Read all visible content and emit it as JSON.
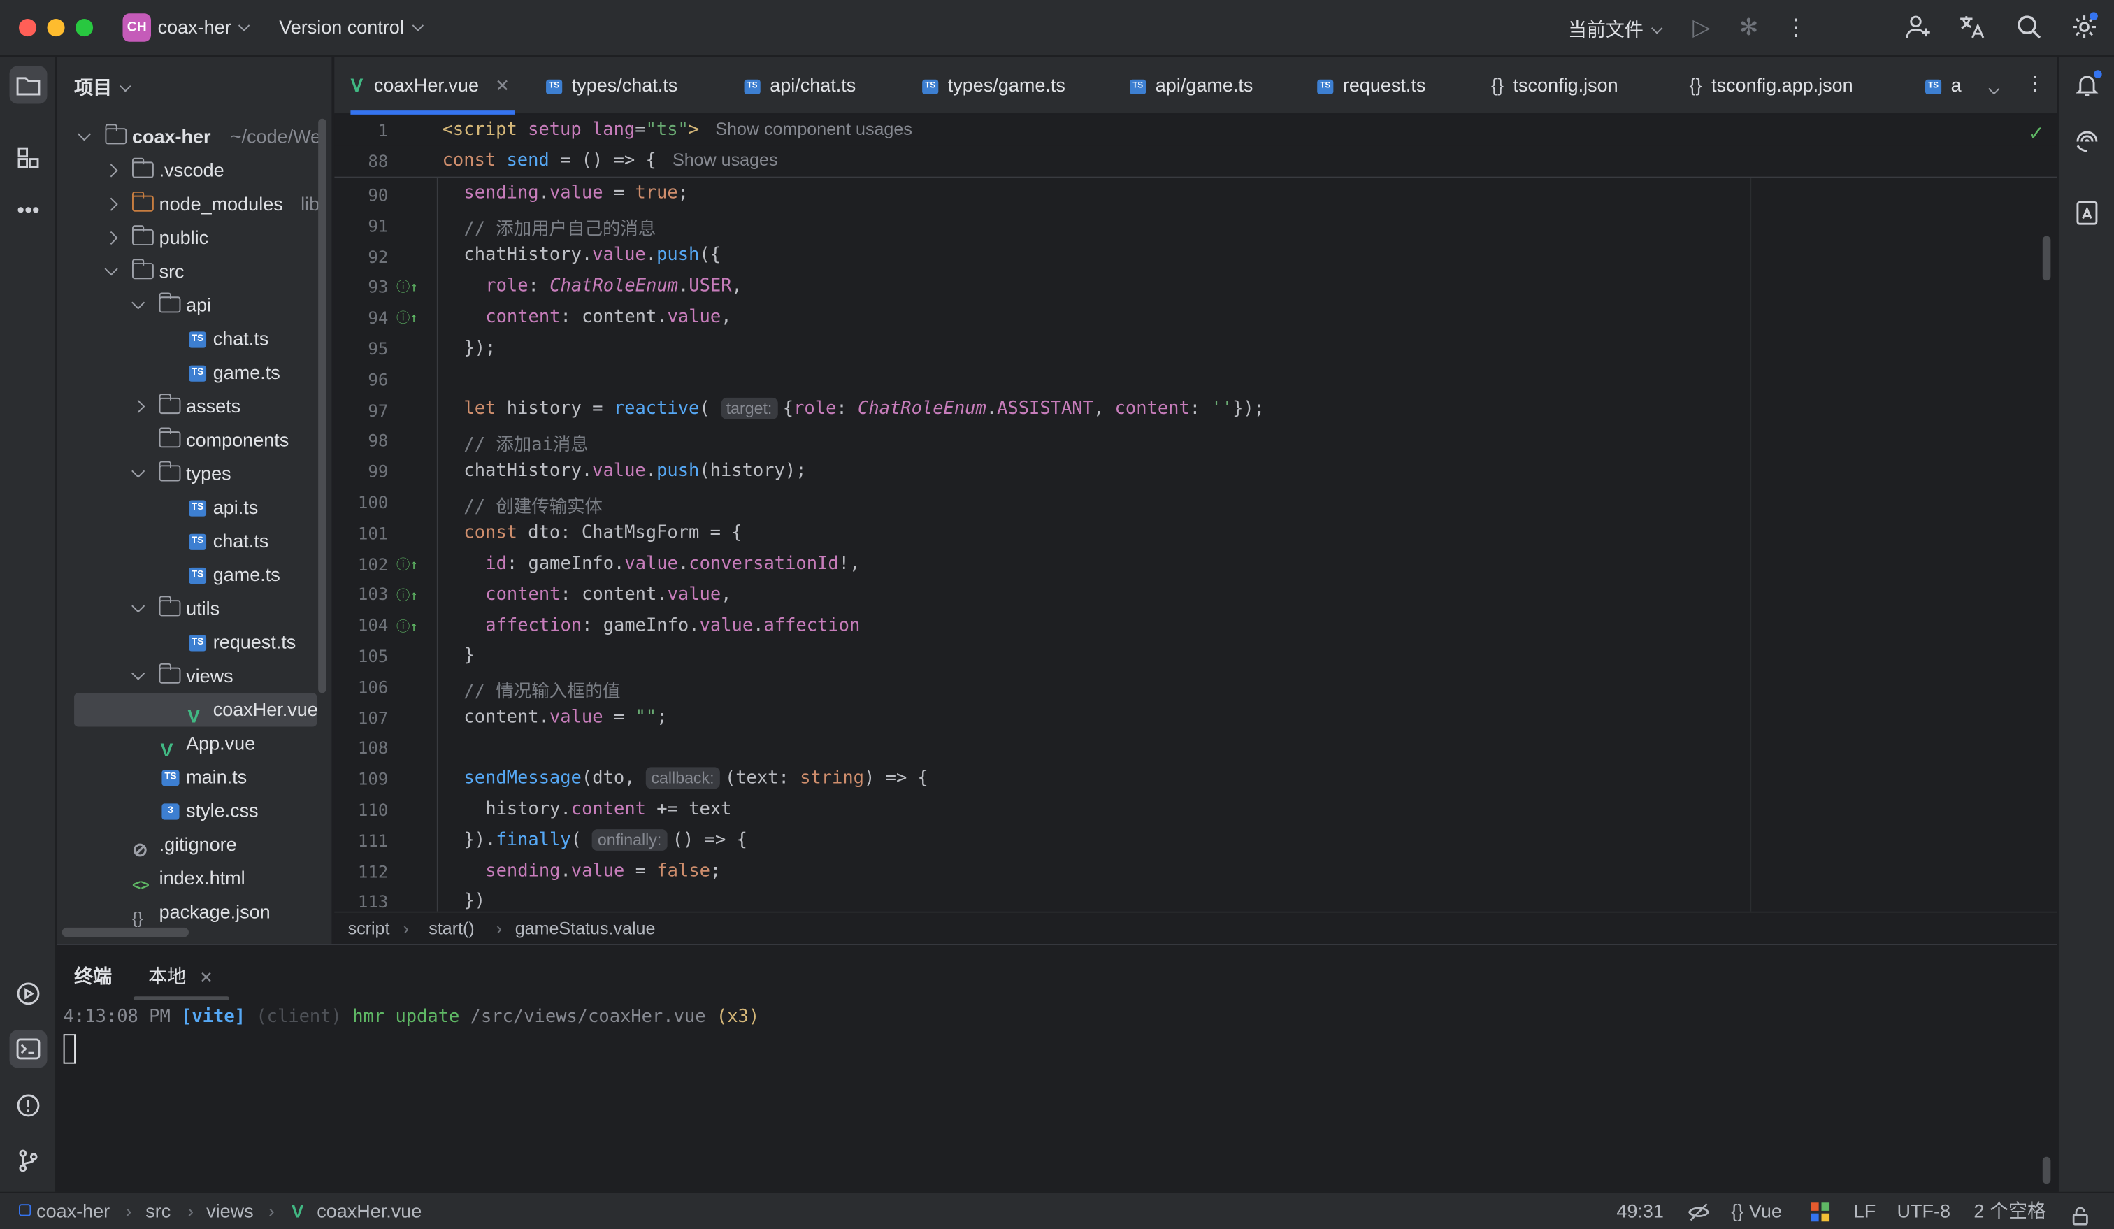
{
  "titlebar": {
    "project_badge": "CH",
    "project_name": "coax-her",
    "vcs_label": "Version control",
    "run_config": "当前文件"
  },
  "project_panel": {
    "title": "项目",
    "items": [
      {
        "label": "coax-her",
        "suffix": "~/code/Wel",
        "type": "folder",
        "depth": 0,
        "expanded": true
      },
      {
        "label": ".vscode",
        "type": "folder",
        "depth": 1,
        "expanded": false
      },
      {
        "label": "node_modules",
        "suffix": "libr",
        "type": "folder-excluded",
        "depth": 1,
        "expanded": false
      },
      {
        "label": "public",
        "type": "folder",
        "depth": 1,
        "expanded": false
      },
      {
        "label": "src",
        "type": "folder",
        "depth": 1,
        "expanded": true
      },
      {
        "label": "api",
        "type": "folder",
        "depth": 2,
        "expanded": true
      },
      {
        "label": "chat.ts",
        "type": "ts",
        "depth": 3
      },
      {
        "label": "game.ts",
        "type": "ts",
        "depth": 3
      },
      {
        "label": "assets",
        "type": "folder",
        "depth": 2,
        "expanded": false
      },
      {
        "label": "components",
        "type": "folder",
        "depth": 2,
        "expanded": null
      },
      {
        "label": "types",
        "type": "folder",
        "depth": 2,
        "expanded": true
      },
      {
        "label": "api.ts",
        "type": "ts",
        "depth": 3
      },
      {
        "label": "chat.ts",
        "type": "ts",
        "depth": 3
      },
      {
        "label": "game.ts",
        "type": "ts",
        "depth": 3
      },
      {
        "label": "utils",
        "type": "folder",
        "depth": 2,
        "expanded": true
      },
      {
        "label": "request.ts",
        "type": "ts",
        "depth": 3
      },
      {
        "label": "views",
        "type": "folder",
        "depth": 2,
        "expanded": true
      },
      {
        "label": "coaxHer.vue",
        "type": "vue",
        "depth": 3,
        "selected": true
      },
      {
        "label": "App.vue",
        "type": "vue",
        "depth": 2
      },
      {
        "label": "main.ts",
        "type": "ts",
        "depth": 2
      },
      {
        "label": "style.css",
        "type": "css",
        "depth": 2
      },
      {
        "label": ".gitignore",
        "type": "ignore",
        "depth": 1
      },
      {
        "label": "index.html",
        "type": "html",
        "depth": 1
      },
      {
        "label": "package.json",
        "type": "json",
        "depth": 1
      }
    ]
  },
  "tabs": [
    {
      "label": "coaxHer.vue",
      "type": "vue",
      "active": true,
      "closable": true
    },
    {
      "label": "types/chat.ts",
      "type": "ts"
    },
    {
      "label": "api/chat.ts",
      "type": "ts"
    },
    {
      "label": "types/game.ts",
      "type": "ts"
    },
    {
      "label": "api/game.ts",
      "type": "ts"
    },
    {
      "label": "request.ts",
      "type": "ts"
    },
    {
      "label": "tsconfig.json",
      "type": "json"
    },
    {
      "label": "tsconfig.app.json",
      "type": "json"
    },
    {
      "label": "a",
      "type": "ts"
    }
  ],
  "editor": {
    "sticky": [
      {
        "num": "1",
        "hint": "Show component usages"
      },
      {
        "num": "88",
        "hint": "Show usages"
      }
    ],
    "line_numbers": [
      "90",
      "91",
      "92",
      "93",
      "94",
      "95",
      "96",
      "97",
      "98",
      "99",
      "100",
      "101",
      "102",
      "103",
      "104",
      "105",
      "106",
      "107",
      "108",
      "109",
      "110",
      "111",
      "112",
      "113"
    ],
    "param_hints": {
      "target": "target:",
      "callback": "callback:",
      "onfinally": "onfinally:"
    }
  },
  "breadcrumb": [
    "script",
    "start()",
    "gameStatus.value"
  ],
  "terminal": {
    "tab_title": "终端",
    "tab_local": "本地",
    "time": "4:13:08 PM",
    "tag": "[vite]",
    "client": "(client)",
    "message": "hmr update",
    "path": "/src/views/coaxHer.vue",
    "count": "(x3)"
  },
  "statusbar": {
    "path": [
      "coax-her",
      "src",
      "views",
      "coaxHer.vue"
    ],
    "position": "49:31",
    "language": "Vue",
    "line_ending": "LF",
    "encoding": "UTF-8",
    "indent": "2 个空格"
  },
  "colors": {
    "accent": "#3574f0",
    "vue": "#41b883",
    "ts": "#3d7fd1",
    "ok": "#5fb865"
  }
}
